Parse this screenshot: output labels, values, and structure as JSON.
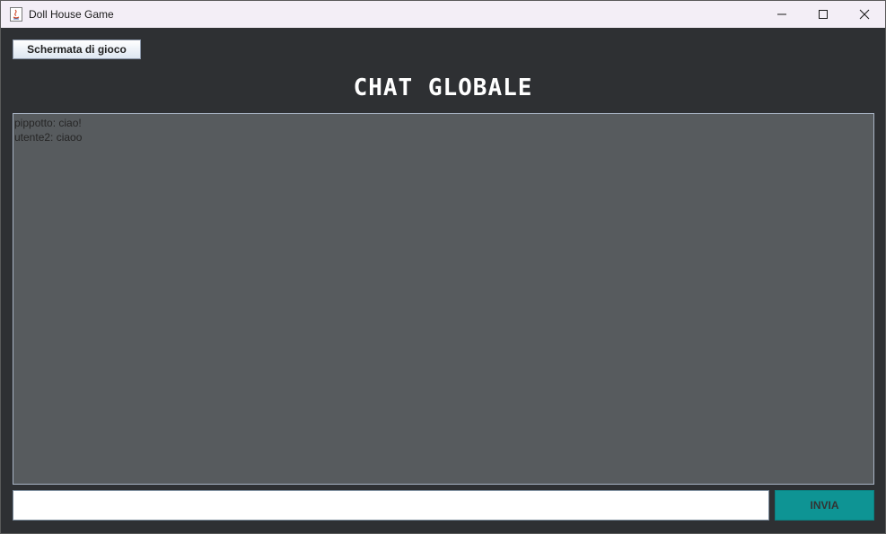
{
  "window": {
    "title": "Doll House Game",
    "icon": "java-icon",
    "controls": [
      "minimize-icon",
      "maximize-icon",
      "close-icon"
    ]
  },
  "toolbar": {
    "game_screen_label": "Schermata di gioco"
  },
  "chat": {
    "title": "CHAT GLOBALE",
    "messages": [
      "pippotto: ciao!",
      "utente2: ciaoo"
    ]
  },
  "composer": {
    "input_value": "",
    "send_label": "INVIA"
  },
  "colors": {
    "background": "#2e3033",
    "chat_area": "#575b5e",
    "send_button": "#0e9494",
    "titlebar": "#f3eef6"
  }
}
